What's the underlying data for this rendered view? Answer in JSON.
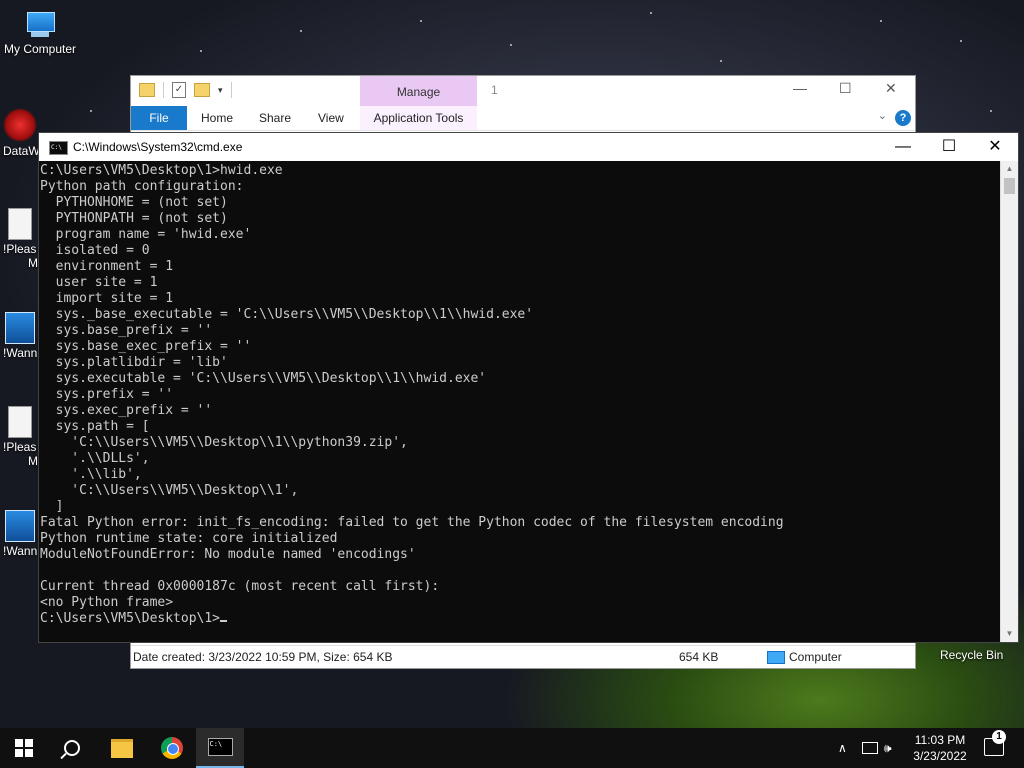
{
  "desktop": {
    "icons": [
      {
        "label": "My Computer"
      },
      {
        "label": "DataW"
      },
      {
        "label": "!Pleas"
      },
      {
        "label": "M"
      },
      {
        "label": "!Wann"
      },
      {
        "label": "!Pleas"
      },
      {
        "label": "M"
      },
      {
        "label": "!Wann"
      }
    ],
    "recycle_bin": "Recycle Bin"
  },
  "explorer": {
    "title": "1",
    "manage_tab": "Manage",
    "tabs": [
      "File",
      "Home",
      "Share",
      "View"
    ],
    "application_tools": "Application Tools",
    "help": "?",
    "status": {
      "details": "Date created: 3/23/2022 10:59 PM, Size: 654 KB",
      "size": "654 KB",
      "location": "Computer"
    }
  },
  "cmd": {
    "title": "C:\\Windows\\System32\\cmd.exe",
    "lines": [
      "C:\\Users\\VM5\\Desktop\\1>hwid.exe",
      "Python path configuration:",
      "  PYTHONHOME = (not set)",
      "  PYTHONPATH = (not set)",
      "  program name = 'hwid.exe'",
      "  isolated = 0",
      "  environment = 1",
      "  user site = 1",
      "  import site = 1",
      "  sys._base_executable = 'C:\\\\Users\\\\VM5\\\\Desktop\\\\1\\\\hwid.exe'",
      "  sys.base_prefix = ''",
      "  sys.base_exec_prefix = ''",
      "  sys.platlibdir = 'lib'",
      "  sys.executable = 'C:\\\\Users\\\\VM5\\\\Desktop\\\\1\\\\hwid.exe'",
      "  sys.prefix = ''",
      "  sys.exec_prefix = ''",
      "  sys.path = [",
      "    'C:\\\\Users\\\\VM5\\\\Desktop\\\\1\\\\python39.zip',",
      "    '.\\\\DLLs',",
      "    '.\\\\lib',",
      "    'C:\\\\Users\\\\VM5\\\\Desktop\\\\1',",
      "  ]",
      "Fatal Python error: init_fs_encoding: failed to get the Python codec of the filesystem encoding",
      "Python runtime state: core initialized",
      "ModuleNotFoundError: No module named 'encodings'",
      "",
      "Current thread 0x0000187c (most recent call first):",
      "<no Python frame>",
      ""
    ],
    "prompt": "C:\\Users\\VM5\\Desktop\\1>"
  },
  "taskbar": {
    "time": "11:03 PM",
    "date": "3/23/2022",
    "notification_count": "1"
  }
}
